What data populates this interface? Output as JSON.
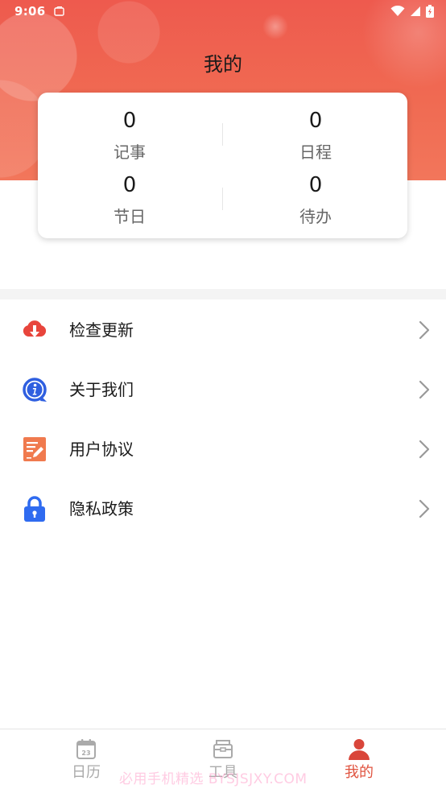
{
  "status_bar": {
    "time": "9:06"
  },
  "header": {
    "title": "我的"
  },
  "stats": [
    {
      "value": "0",
      "label": "记事"
    },
    {
      "value": "0",
      "label": "日程"
    },
    {
      "value": "0",
      "label": "节日"
    },
    {
      "value": "0",
      "label": "待办"
    }
  ],
  "menu": [
    {
      "label": "检查更新",
      "icon": "cloud-download-icon"
    },
    {
      "label": "关于我们",
      "icon": "info-icon"
    },
    {
      "label": "用户协议",
      "icon": "document-edit-icon"
    },
    {
      "label": "隐私政策",
      "icon": "lock-icon"
    }
  ],
  "nav": [
    {
      "label": "日历",
      "icon": "calendar-icon",
      "calendar_day": "23",
      "active": false
    },
    {
      "label": "工具",
      "icon": "toolbox-icon",
      "active": false
    },
    {
      "label": "我的",
      "icon": "person-icon",
      "active": true
    }
  ],
  "watermark": "必用手机精选 BYSJSJXY.COM",
  "colors": {
    "accent": "#e0533f",
    "header": "#ee5a4e",
    "update_icon": "#e8453c",
    "info_icon": "#2f5fe0",
    "agreement_icon": "#f07a4e",
    "privacy_icon": "#2f6bf0"
  }
}
